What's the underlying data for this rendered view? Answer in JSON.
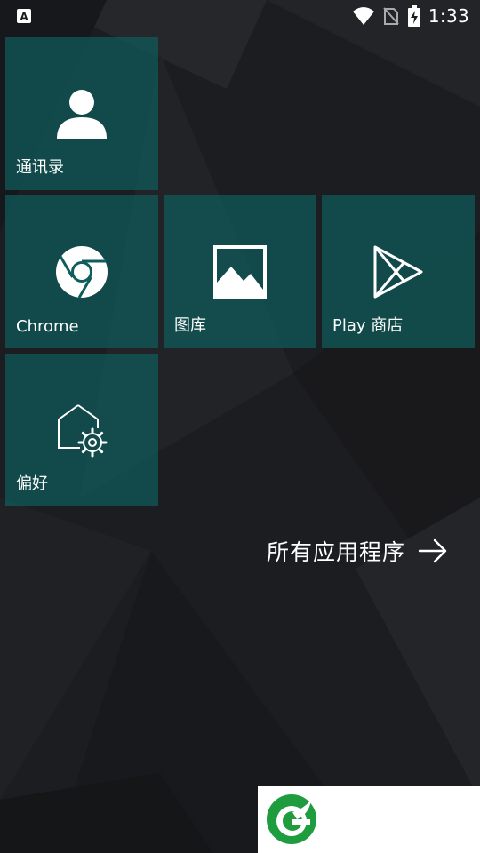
{
  "status_bar": {
    "time": "1:33",
    "icons": [
      "notification-a-icon",
      "wifi-icon",
      "no-sim-icon",
      "battery-charging-icon"
    ]
  },
  "tiles": [
    {
      "label": "通讯录",
      "icon": "person-icon"
    },
    {
      "label": "Chrome",
      "icon": "chrome-icon"
    },
    {
      "label": "图库",
      "icon": "gallery-icon"
    },
    {
      "label": "Play 商店",
      "icon": "play-store-icon"
    },
    {
      "label": "偏好",
      "icon": "preferences-icon"
    }
  ],
  "all_apps": {
    "label": "所有应用程序",
    "icon": "arrow-right-icon"
  },
  "colors": {
    "tile": "#0f5c5c",
    "background": "#1b1c1f",
    "logo_green": "#1e9c3e"
  }
}
